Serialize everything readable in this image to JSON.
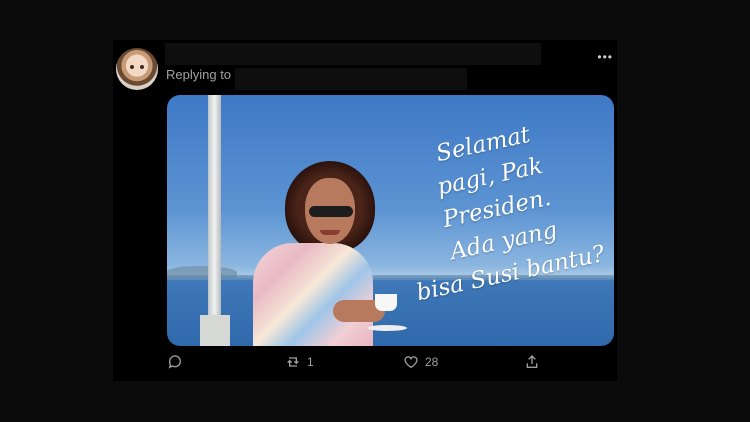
{
  "tweet": {
    "replying_label": "Replying to",
    "more_icon": "more-horizontal-icon",
    "image": {
      "caption_lines": [
        "Selamat",
        "pagi, Pak Presiden.",
        "Ada yang",
        "bisa Susi bantu?"
      ]
    },
    "actions": {
      "reply": {
        "icon": "reply-icon",
        "count": ""
      },
      "retweet": {
        "icon": "retweet-icon",
        "count": "1"
      },
      "like": {
        "icon": "heart-icon",
        "count": "28"
      },
      "share": {
        "icon": "share-icon",
        "count": ""
      }
    }
  }
}
